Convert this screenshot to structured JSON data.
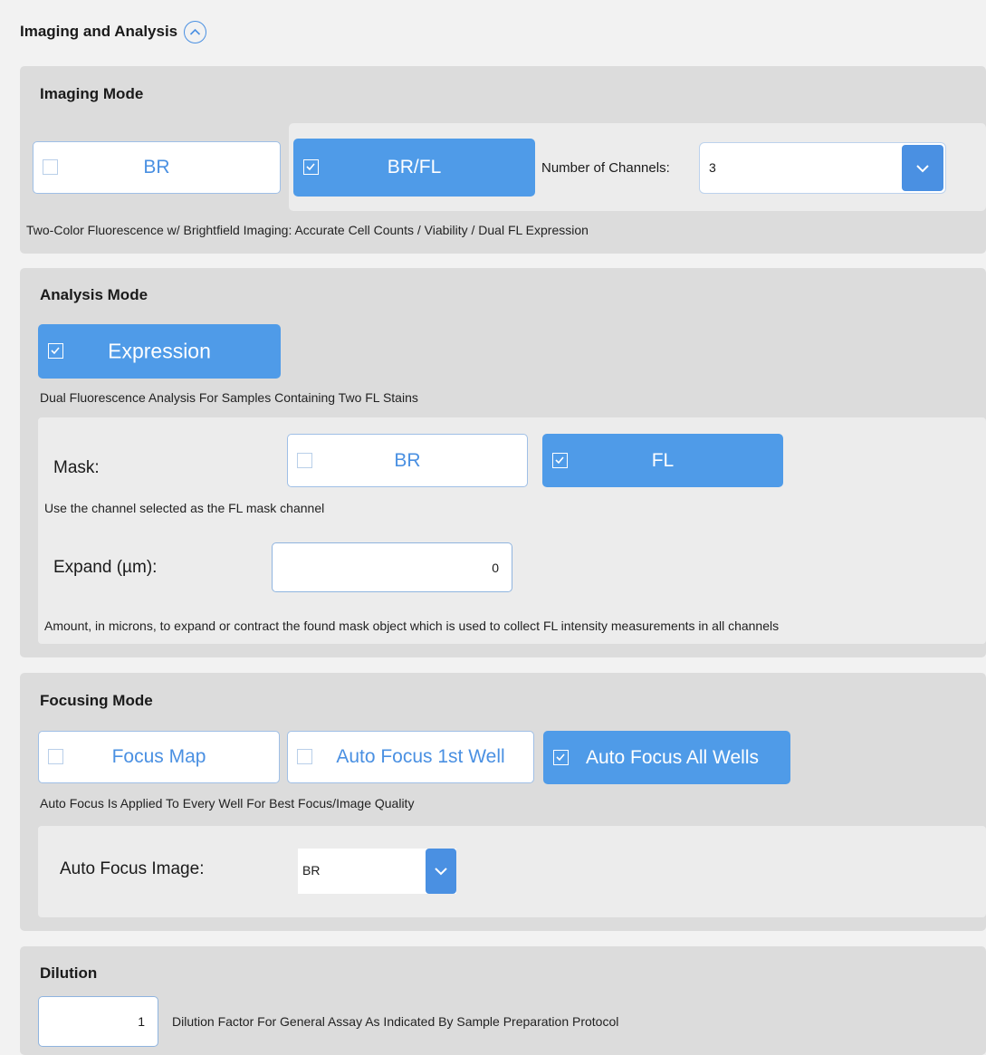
{
  "header": {
    "title": "Imaging and Analysis"
  },
  "imaging": {
    "title": "Imaging Mode",
    "btn_br": "BR",
    "btn_brfl": "BR/FL",
    "channels_label": "Number of Channels:",
    "channels_value": "3",
    "description": "Two-Color Fluorescence w/ Brightfield Imaging: Accurate Cell Counts / Viability / Dual FL Expression"
  },
  "analysis": {
    "title": "Analysis Mode",
    "btn_expression": "Expression",
    "description": "Dual Fluorescence Analysis For Samples Containing Two FL Stains",
    "mask_label": "Mask:",
    "mask_br": "BR",
    "mask_fl": "FL",
    "mask_description": "Use the channel selected as the FL mask channel",
    "expand_label": "Expand (µm):",
    "expand_value": "0",
    "expand_description": "Amount, in microns, to expand or contract the found mask object which is used to collect FL intensity measurements in all channels"
  },
  "focusing": {
    "title": "Focusing Mode",
    "btn_focus_map": "Focus Map",
    "btn_af_first": "Auto Focus 1st Well",
    "btn_af_all": "Auto Focus All Wells",
    "description": "Auto Focus Is Applied To Every Well For Best Focus/Image Quality",
    "af_image_label": "Auto Focus Image:",
    "af_image_value": "BR"
  },
  "dilution": {
    "title": "Dilution",
    "value": "1",
    "description": "Dilution Factor For General Assay As Indicated By Sample Preparation Protocol"
  },
  "colors": {
    "accent": "#4f9be8",
    "panel": "#dcdcdc",
    "inner": "#ececec"
  }
}
